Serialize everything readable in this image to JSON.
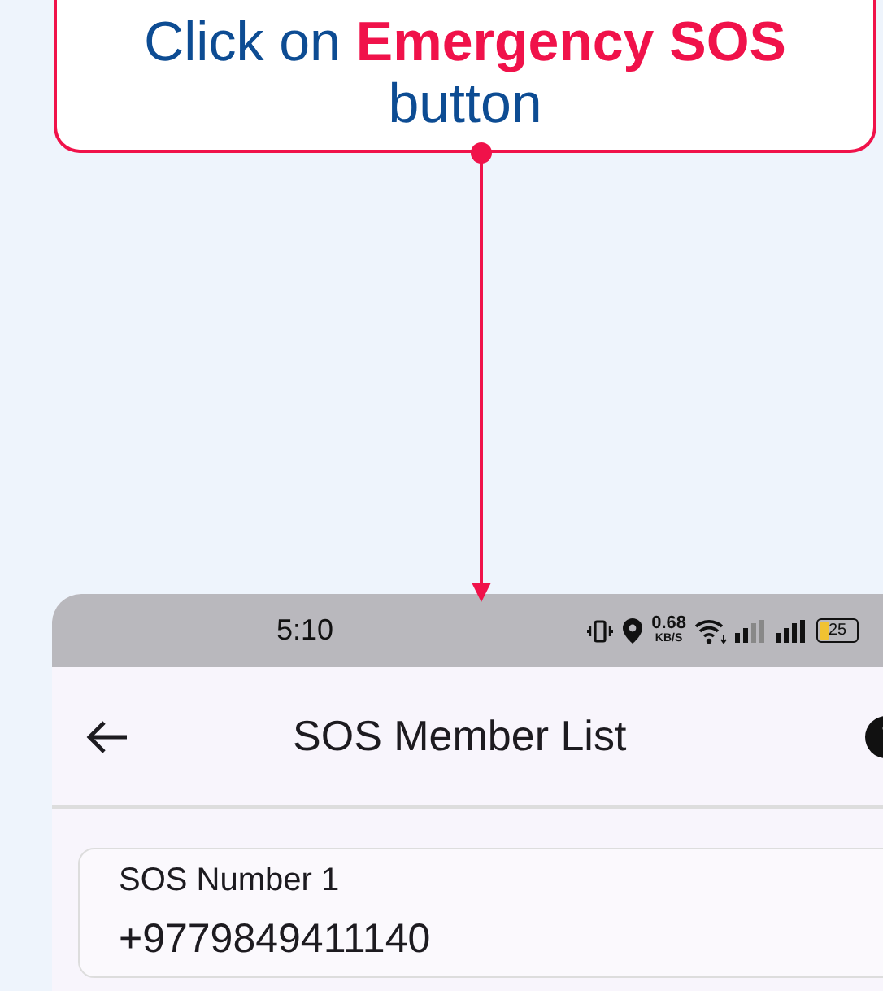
{
  "callout": {
    "text": "Click on **Emergency SOS** button"
  },
  "status_bar": {
    "time": "5:10",
    "speed": "0.68",
    "speed_unit": "KB/S",
    "battery": "25"
  },
  "app_bar": {
    "title": "SOS Member List"
  },
  "members": [
    {
      "label": "SOS Number 1",
      "number": "+9779849411140"
    }
  ]
}
